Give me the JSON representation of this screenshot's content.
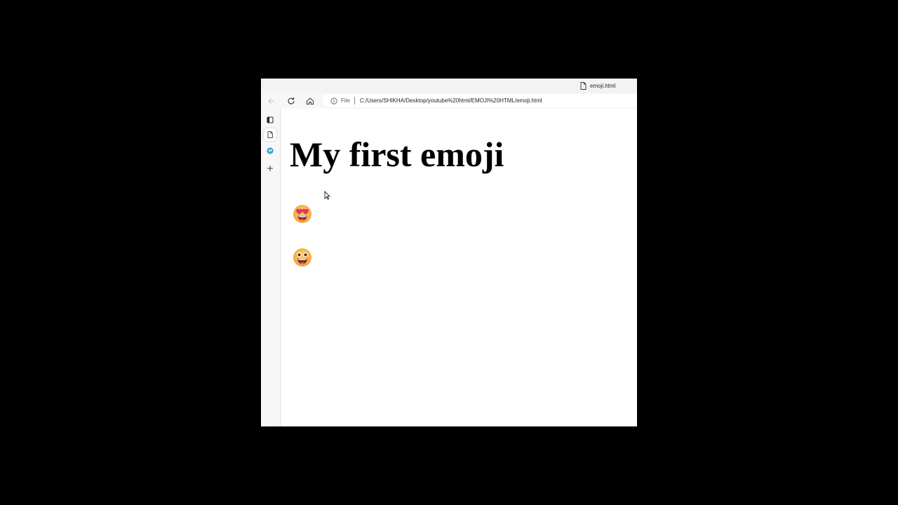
{
  "tab": {
    "title": "emoji.html"
  },
  "toolbar": {
    "address": {
      "scheme": "File",
      "url": "C:/Users/SHIKHA/Desktop/youtube%20html/EMOJI%20HTML/emoji.html"
    }
  },
  "sidebar": {
    "items": [
      {
        "icon": "tab-actions-icon"
      },
      {
        "icon": "page-icon",
        "active": true
      },
      {
        "icon": "edge-logo-icon"
      },
      {
        "icon": "plus-icon"
      }
    ]
  },
  "page": {
    "heading": "My first emoji",
    "emojis": [
      {
        "icon": "heart-eyes-emoji-icon"
      },
      {
        "icon": "grinning-face-emoji-icon"
      }
    ]
  },
  "colors": {
    "background": "#000000",
    "chrome": "#f7f7f7",
    "emoji_face": "#f7b946",
    "emoji_heart": "#e8336b"
  }
}
